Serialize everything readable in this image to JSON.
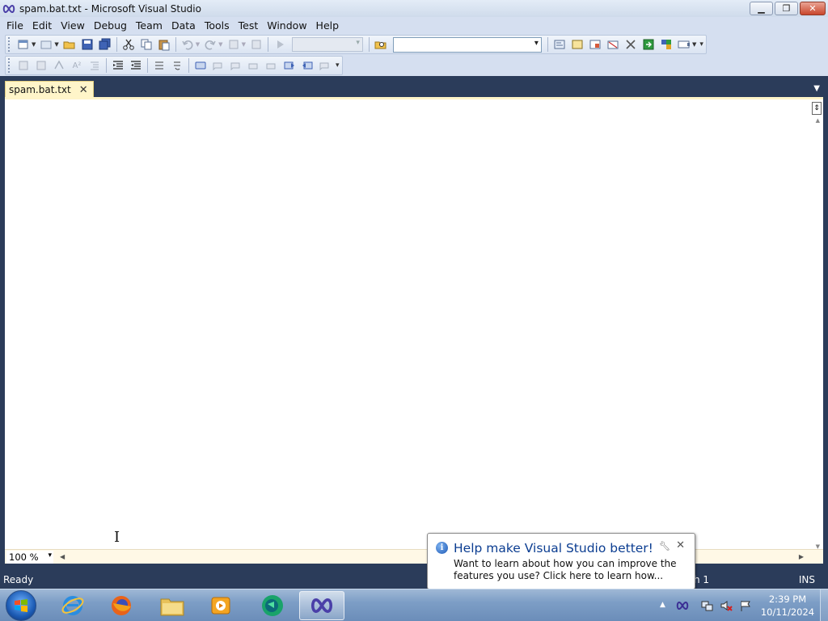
{
  "window": {
    "title": "spam.bat.txt - Microsoft Visual Studio",
    "minimize": "▭",
    "restore": "❐",
    "close": "✕"
  },
  "menu": [
    "File",
    "Edit",
    "View",
    "Debug",
    "Team",
    "Data",
    "Tools",
    "Test",
    "Window",
    "Help"
  ],
  "editor": {
    "tab_label": "spam.bat.txt",
    "tab_close": "✕",
    "caret": "I",
    "zoom": "100 %"
  },
  "status": {
    "text": "Ready",
    "line": "h 1",
    "mode": "INS"
  },
  "notification": {
    "title": "Help make Visual Studio better!",
    "body": "Want to learn about how you can improve the features you use? Click here to learn how...",
    "info": "i"
  },
  "clock": {
    "time": "2:39 PM",
    "date": "10/11/2024"
  },
  "colors": {
    "accent": "#2b3c5a",
    "tab": "#fff5c9",
    "link": "#0b3d91"
  }
}
